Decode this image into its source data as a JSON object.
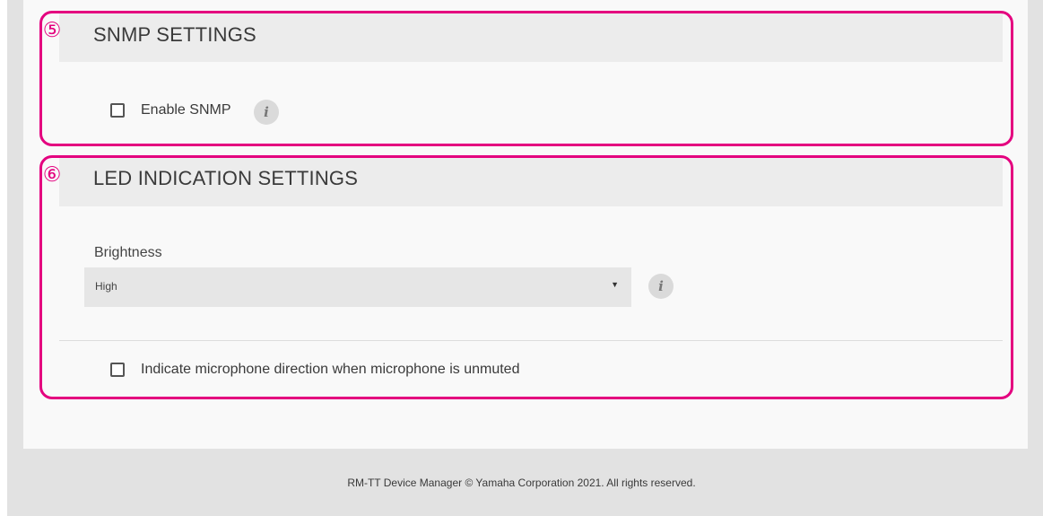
{
  "snmp": {
    "callout": "⑤",
    "title": "SNMP SETTINGS",
    "enable_label": "Enable SNMP",
    "info_glyph": "i"
  },
  "led": {
    "callout": "⑥",
    "title": "LED INDICATION SETTINGS",
    "brightness_label": "Brightness",
    "brightness_value": "High",
    "info_glyph": "i",
    "mic_direction_label": "Indicate microphone direction when microphone is unmuted"
  },
  "footer": {
    "text": "RM-TT Device Manager © Yamaha Corporation 2021. All rights reserved."
  },
  "colors": {
    "callout_accent": "#e4007f",
    "header_bg": "#ececec",
    "panel_bg": "#f9f9f9",
    "outer_bg": "#e2e2e2"
  },
  "icons": {
    "info": "info-icon",
    "caret": "caret-down-icon",
    "checkbox": "checkbox-unchecked"
  }
}
